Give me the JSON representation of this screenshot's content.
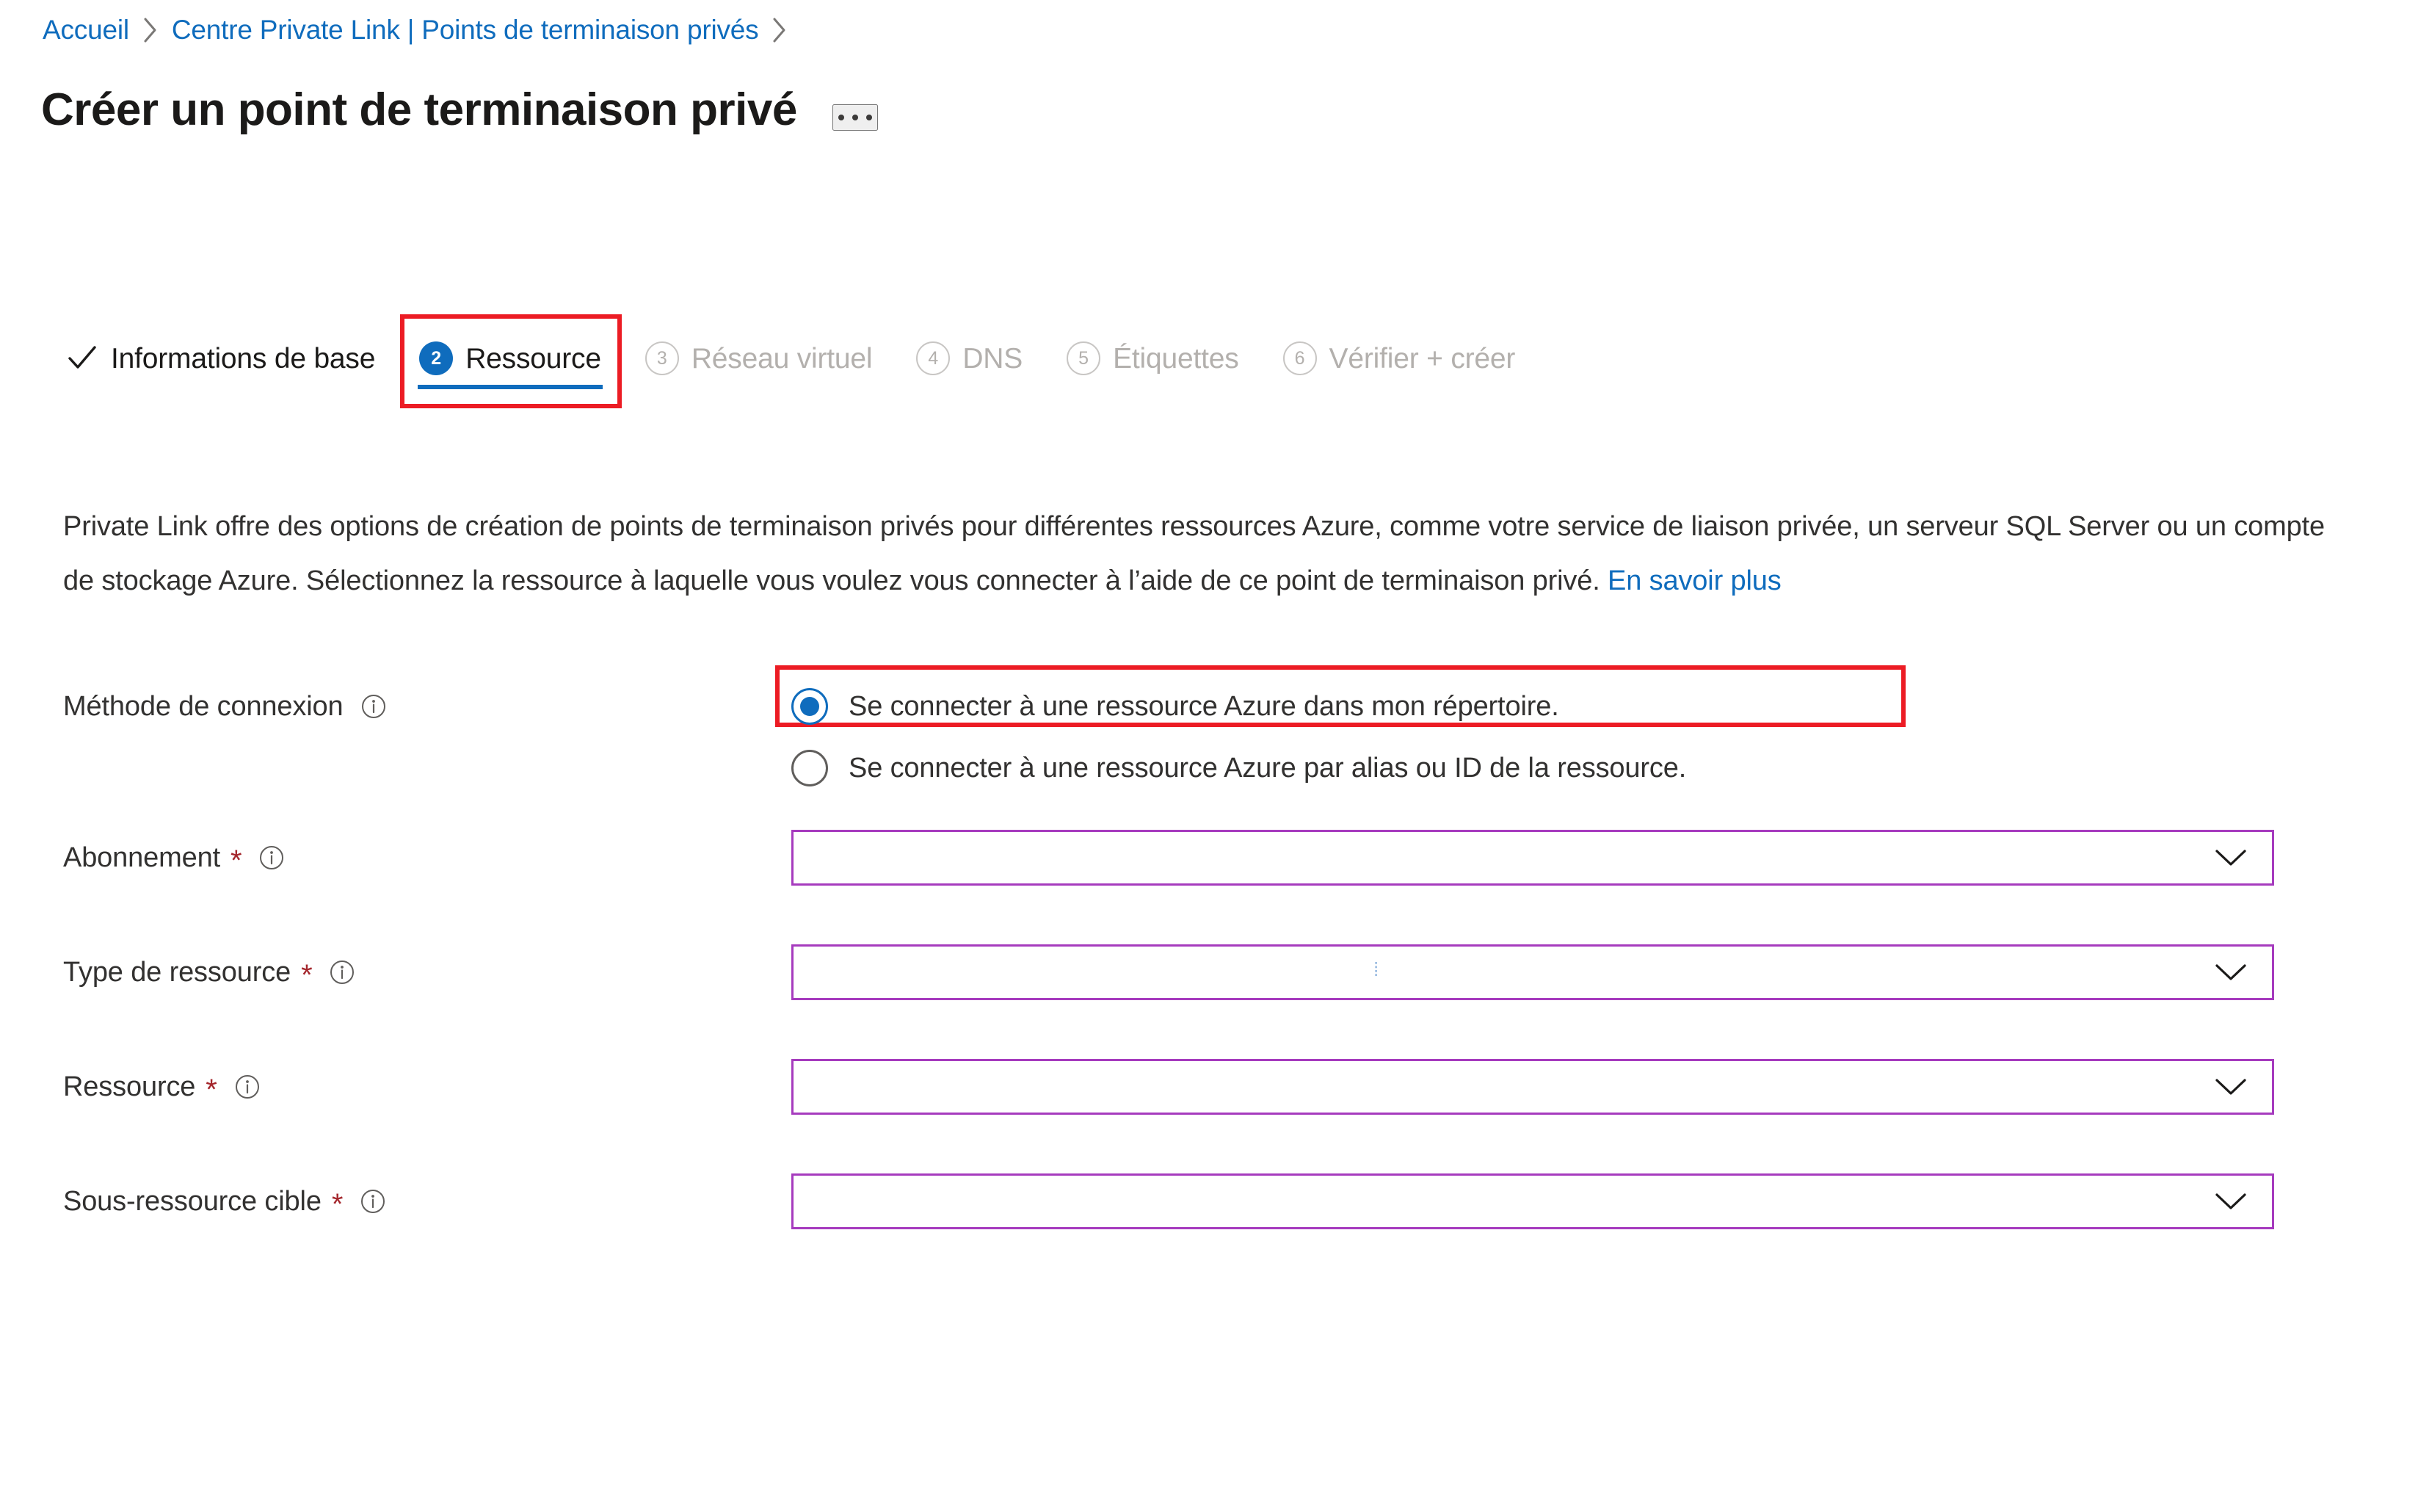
{
  "breadcrumb": {
    "items": [
      {
        "label": "Accueil"
      },
      {
        "label": "Centre Private Link | Points de terminaison privés"
      }
    ]
  },
  "header": {
    "title": "Créer un point de terminaison privé",
    "more_actions": "…"
  },
  "tabs": [
    {
      "label": "Informations de base",
      "state": "completed",
      "marker": "check"
    },
    {
      "label": "Ressource",
      "state": "active",
      "marker": "2"
    },
    {
      "label": "Réseau virtuel",
      "state": "disabled",
      "marker": "3"
    },
    {
      "label": "DNS",
      "state": "disabled",
      "marker": "4"
    },
    {
      "label": "Étiquettes",
      "state": "disabled",
      "marker": "5"
    },
    {
      "label": "Vérifier + créer",
      "state": "disabled",
      "marker": "6"
    }
  ],
  "description": {
    "text": "Private Link offre des options de création de points de terminaison privés pour différentes ressources Azure, comme votre service de liaison privée, un serveur SQL Server ou un compte de stockage Azure. Sélectionnez la ressource à laquelle vous voulez vous connecter à l’aide de ce point de terminaison privé. ",
    "link_label": "En savoir plus"
  },
  "form": {
    "connection_method": {
      "label": "Méthode de connexion",
      "required": false,
      "options": [
        {
          "label": "Se connecter à une ressource Azure dans mon répertoire.",
          "selected": true
        },
        {
          "label": "Se connecter à une ressource Azure par alias ou ID de la ressource.",
          "selected": false
        }
      ]
    },
    "fields": [
      {
        "label": "Abonnement",
        "required_mark": "*",
        "value": "",
        "placeholder": "",
        "control": "dropdown"
      },
      {
        "label": "Type de ressource",
        "required_mark": "*",
        "value": "",
        "placeholder": "",
        "control": "dropdown"
      },
      {
        "label": "Ressource",
        "required_mark": "*",
        "value": "",
        "placeholder": "",
        "control": "dropdown"
      },
      {
        "label": "Sous-ressource cible",
        "required_mark": "*",
        "value": "",
        "placeholder": "",
        "control": "dropdown"
      }
    ]
  },
  "colors": {
    "link": "#0f6cbd",
    "accent": "#0f6cbd",
    "annotation_red": "#ec1c24",
    "field_border_purple": "#a63bbe",
    "required_red": "#a4262c",
    "disabled_gray": "#b3b0ad"
  }
}
